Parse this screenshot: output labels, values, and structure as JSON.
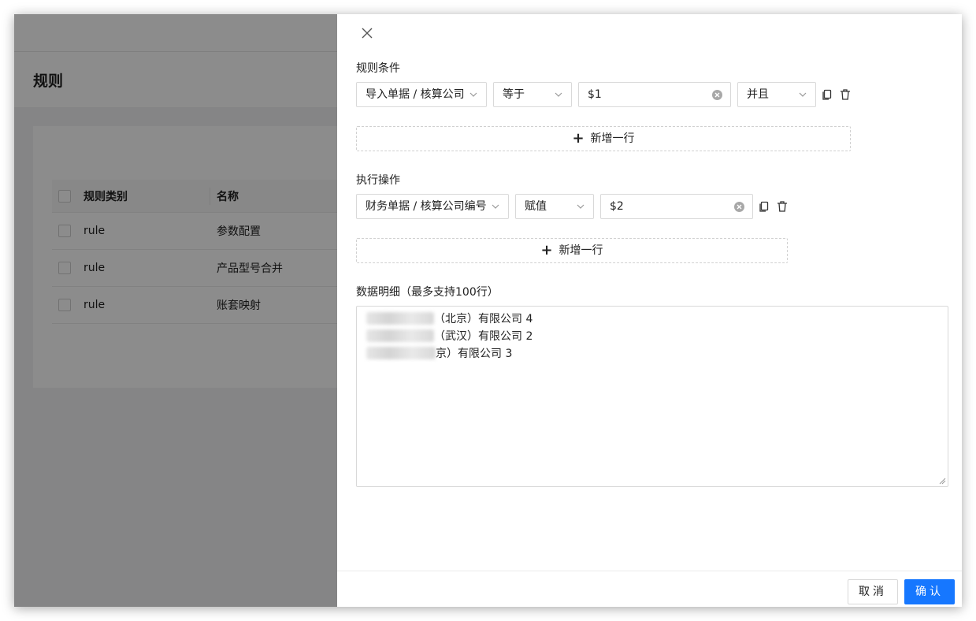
{
  "background": {
    "page_title": "规则",
    "table": {
      "headers": [
        "规则类别",
        "名称"
      ],
      "rows": [
        {
          "category": "rule",
          "name": "参数配置"
        },
        {
          "category": "rule",
          "name": "产品型号合并"
        },
        {
          "category": "rule",
          "name": "账套映射"
        }
      ]
    }
  },
  "drawer": {
    "conditions": {
      "label": "规则条件",
      "field_select": "导入单据 / 核算公司",
      "operator_select": "等于",
      "value_input": "$1",
      "logic_select": "并且",
      "add_row_label": "新增一行"
    },
    "actions": {
      "label": "执行操作",
      "field_select": "财务单据 / 核算公司编号",
      "operator_select": "赋值",
      "value_input": "$2",
      "add_row_label": "新增一行"
    },
    "details": {
      "label": "数据明细（最多支持100行）",
      "lines": [
        "（北京）有限公司 4",
        "（武汉）有限公司 2",
        "京）有限公司 3"
      ]
    },
    "footer": {
      "cancel_label": "取消",
      "confirm_label": "确认"
    }
  },
  "colors": {
    "primary": "#1677ff",
    "overlay": "rgba(0,0,0,0.45)"
  },
  "icons": [
    "close-icon",
    "chevron-down-icon",
    "clear-icon",
    "copy-icon",
    "delete-icon",
    "plus-icon"
  ]
}
